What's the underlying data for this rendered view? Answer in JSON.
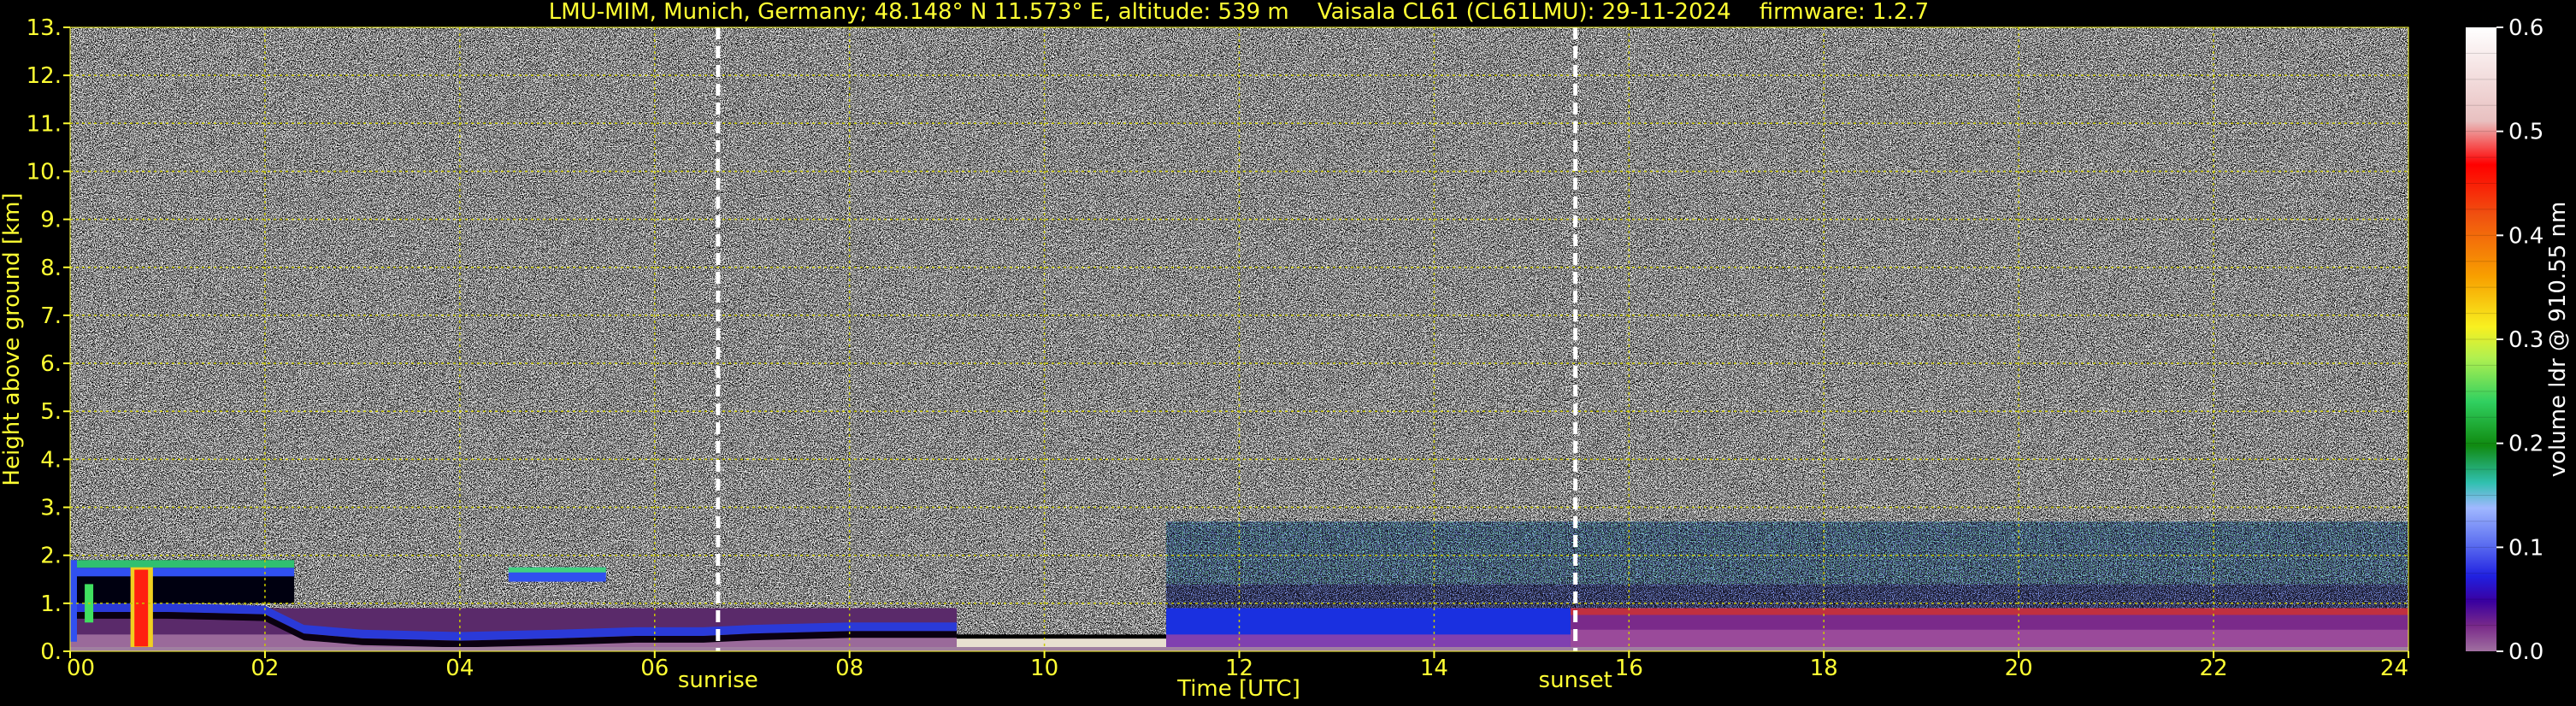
{
  "chart_data": {
    "type": "heatmap",
    "title": "LMU-MIM, Munich, Germany; 48.148° N 11.573° E, altitude: 539 m    Vaisala CL61 (CL61LMU): 29-11-2024    firmware: 1.2.7",
    "xlabel": "Time [UTC]",
    "ylabel": "Height above ground [km]",
    "xlim": [
      0,
      24
    ],
    "ylim": [
      0,
      13
    ],
    "x_ticks": [
      "00",
      "02",
      "04",
      "06",
      "08",
      "10",
      "12",
      "14",
      "16",
      "18",
      "20",
      "22",
      "24"
    ],
    "y_ticks": [
      "0.",
      "1.",
      "2.",
      "3.",
      "4.",
      "5.",
      "6.",
      "7.",
      "8.",
      "9.",
      "10.",
      "11.",
      "12.",
      "13."
    ],
    "grid": true,
    "events": [
      {
        "label": "sunrise",
        "time": 6.65
      },
      {
        "label": "sunset",
        "time": 15.45
      }
    ],
    "colorbar": {
      "label": "volume ldr @ 910.55 nm",
      "range": [
        0.0,
        0.6
      ],
      "ticks": [
        "0.0",
        "0.1",
        "0.2",
        "0.3",
        "0.4",
        "0.5",
        "0.6"
      ]
    },
    "colors": {
      "axis_text": "#ffff33",
      "cb_text": "#ffffff",
      "grid": "#c8c800",
      "background": "#000000"
    },
    "features": [
      {
        "name": "aerosol-layer-early",
        "t_start": 0.0,
        "t_end": 9.1,
        "top_km": 0.9
      },
      {
        "name": "low-cloud-early",
        "t_start": 0.0,
        "t_end": 2.3,
        "top_km": 1.9
      },
      {
        "name": "cloud-patch-mid",
        "t_start": 4.5,
        "t_end": 5.5,
        "top_km": 1.75
      },
      {
        "name": "low-signal-gap",
        "t_start": 9.1,
        "t_end": 11.25,
        "top_km": 0.3
      },
      {
        "name": "boundary-layer-late",
        "t_start": 11.25,
        "t_end": 24.0,
        "top_km": 0.9
      },
      {
        "name": "elevated-aerosol-late",
        "t_start": 11.25,
        "t_end": 24.0,
        "top_km": 2.7
      }
    ]
  }
}
